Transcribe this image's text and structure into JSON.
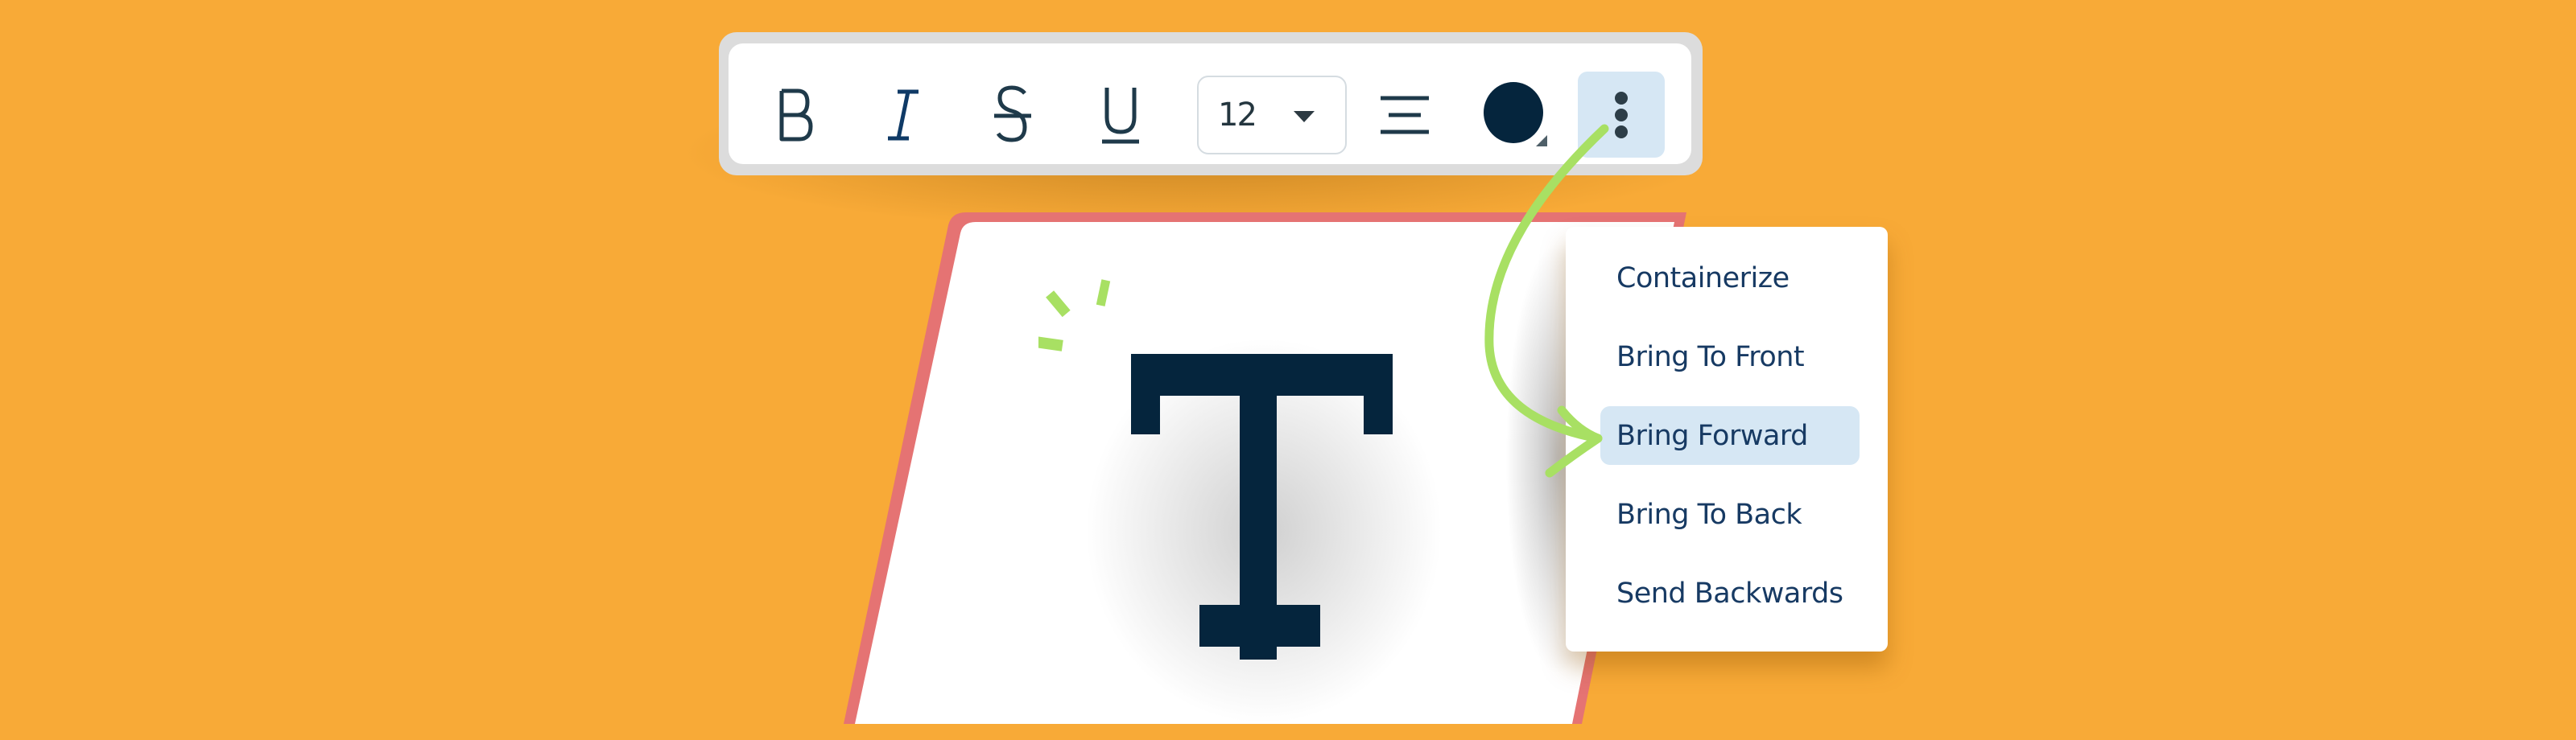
{
  "colors": {
    "background": "#F8AA37",
    "toolbar_frame": "#DCDCDC",
    "icon": "#1f3a4a",
    "accent_highlight": "#D6E7F4",
    "text_color_swatch": "#05253D",
    "menu_text": "#173a63",
    "paper_border": "#E57373",
    "arrow": "#A8E063",
    "big_T": "#05253D"
  },
  "toolbar": {
    "buttons": [
      {
        "id": "bold",
        "icon": "bold-icon",
        "glyph": "B"
      },
      {
        "id": "italic",
        "icon": "italic-icon",
        "glyph": "I"
      },
      {
        "id": "strikethrough",
        "icon": "strikethrough-icon",
        "glyph": "S"
      },
      {
        "id": "underline",
        "icon": "underline-icon",
        "glyph": "U"
      }
    ],
    "font_size": {
      "value": "12",
      "icon": "caret-down-icon"
    },
    "align_icon": "align-center-icon",
    "color_picker": {
      "icon": "color-swatch-icon",
      "value": "#05253D"
    },
    "more_button": {
      "icon": "more-vertical-icon",
      "active": true
    }
  },
  "context_menu": {
    "items": [
      {
        "label": "Containerize",
        "active": false
      },
      {
        "label": "Bring To Front",
        "active": false
      },
      {
        "label": "Bring Forward",
        "active": true
      },
      {
        "label": "Bring To Back",
        "active": false
      },
      {
        "label": "Send Backwards",
        "active": false
      }
    ]
  },
  "canvas": {
    "text_element_icon": "text-T-icon"
  }
}
